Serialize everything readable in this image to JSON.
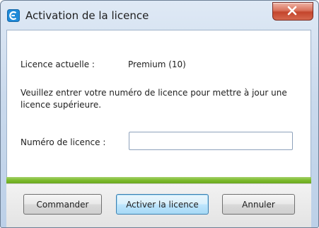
{
  "window": {
    "title": "Activation de la licence",
    "close_icon": "close-x-icon",
    "app_icon": "app-icon"
  },
  "licence": {
    "current_label": "Licence actuelle :",
    "current_value": "Premium (10)",
    "instruction": "Veuillez entrer votre numéro de licence pour mettre à jour une licence supérieure.",
    "field_label": "Numéro de licence :",
    "field_value": "",
    "field_placeholder": ""
  },
  "buttons": {
    "order_label": "Commander",
    "activate_label": "Activer la licence",
    "cancel_label": "Annuler"
  },
  "colors": {
    "accent_green": "#7cbb2c",
    "close_red": "#c4452c",
    "default_button_blue": "#3c7fb1"
  }
}
